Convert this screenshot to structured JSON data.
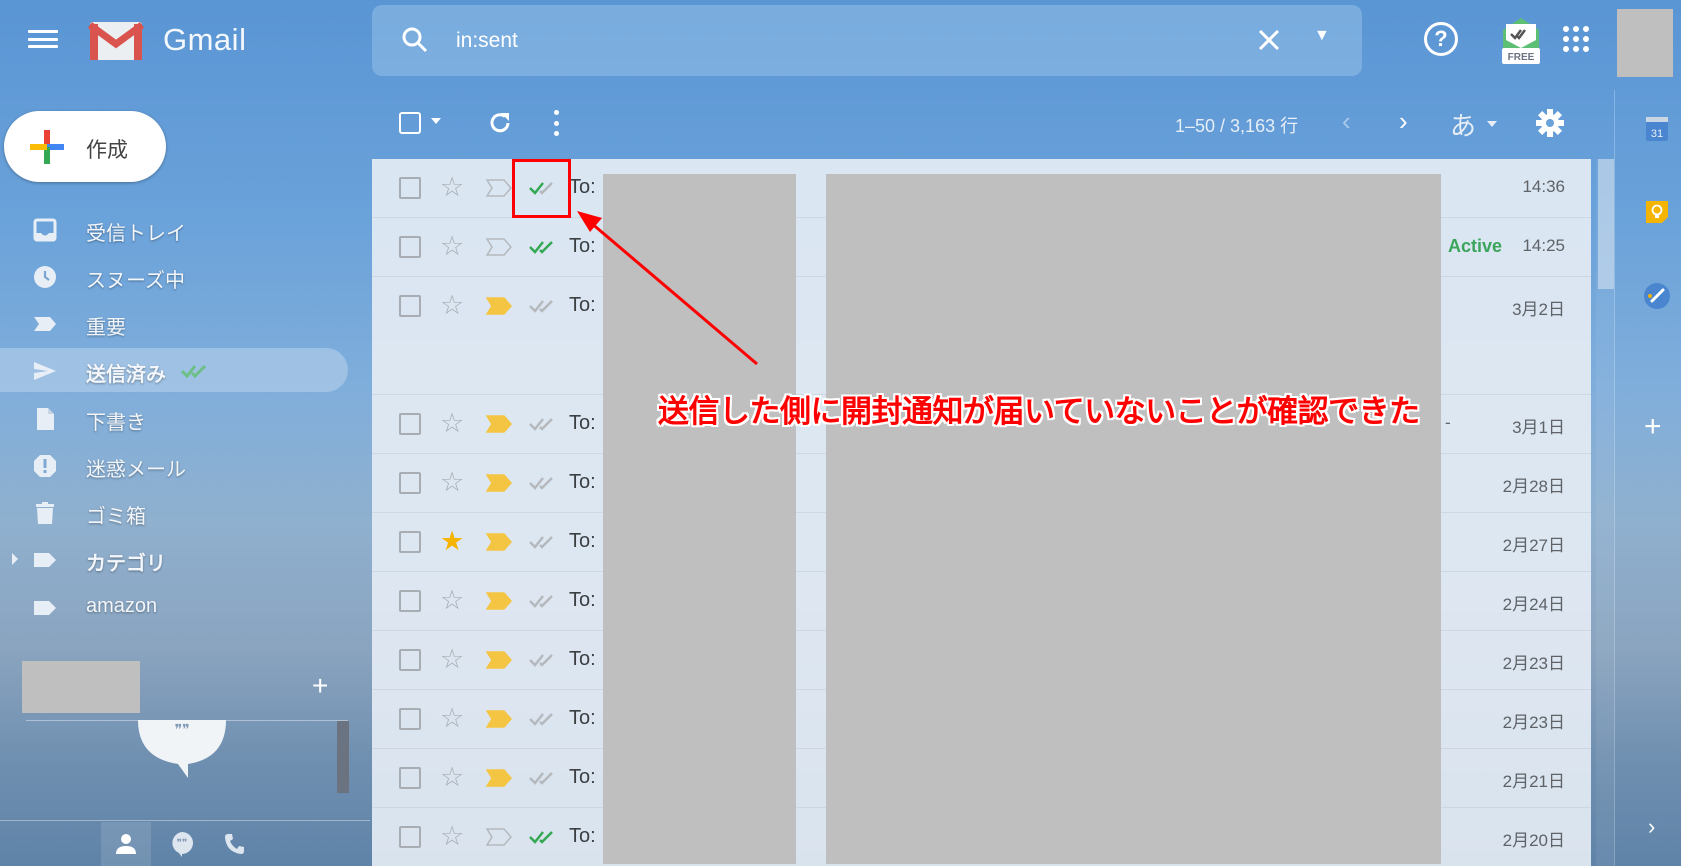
{
  "header": {
    "app_name": "Gmail",
    "search_value": "in:sent",
    "search_clear_icon": "close-icon",
    "search_options_icon": "arrow-drop-down-icon",
    "help_icon": "help-icon",
    "extension_badge": "FREE",
    "apps_icon": "apps-grid-icon"
  },
  "compose": {
    "label": "作成"
  },
  "sidebar": {
    "items": [
      {
        "label": "受信トレイ",
        "icon": "inbox-icon"
      },
      {
        "label": "スヌーズ中",
        "icon": "clock-icon"
      },
      {
        "label": "重要",
        "icon": "important-icon"
      },
      {
        "label": "送信済み",
        "icon": "send-icon",
        "active": true
      },
      {
        "label": "下書き",
        "icon": "draft-icon"
      },
      {
        "label": "迷惑メール",
        "icon": "spam-icon"
      },
      {
        "label": "ゴミ箱",
        "icon": "trash-icon"
      },
      {
        "label": "カテゴリ",
        "icon": "label-icon",
        "expandable": true
      },
      {
        "label": "amazon",
        "icon": "label-icon"
      }
    ]
  },
  "toolbar": {
    "count_text": "1–50 / 3,163 行",
    "language": "あ"
  },
  "mails": [
    {
      "to": "To:",
      "starred": false,
      "important": false,
      "read_status": "partial",
      "active": "",
      "date": "14:36"
    },
    {
      "to": "To:",
      "starred": false,
      "important": false,
      "read_status": "read",
      "active": "Active",
      "date": "14:25"
    },
    {
      "to": "To:",
      "starred": false,
      "important": true,
      "read_status": "unread",
      "active": "",
      "date": "3月2日"
    },
    {
      "to": "To:",
      "starred": false,
      "important": true,
      "read_status": "unread",
      "active": "",
      "date": "3月1日",
      "dash": "-"
    },
    {
      "to": "To:",
      "starred": false,
      "important": true,
      "read_status": "unread",
      "active": "",
      "date": "2月28日"
    },
    {
      "to": "To:",
      "starred": true,
      "important": true,
      "read_status": "unread",
      "active": "",
      "date": "2月27日"
    },
    {
      "to": "To:",
      "starred": false,
      "important": true,
      "read_status": "unread",
      "active": "",
      "date": "2月24日"
    },
    {
      "to": "To:",
      "starred": false,
      "important": true,
      "read_status": "unread",
      "active": "",
      "date": "2月23日"
    },
    {
      "to": "To:",
      "starred": false,
      "important": true,
      "read_status": "unread",
      "active": "",
      "date": "2月23日"
    },
    {
      "to": "To:",
      "starred": false,
      "important": true,
      "read_status": "unread",
      "active": "",
      "date": "2月21日"
    },
    {
      "to": "To:",
      "starred": false,
      "important": false,
      "read_status": "read",
      "active": "",
      "date": "2月20日"
    }
  ],
  "side_panel": {
    "calendar_day": "31"
  },
  "annotation": {
    "text": "送信した側に開封通知が届いていないことが確認できた"
  },
  "colors": {
    "read_green": "#34a853",
    "unread_gray": "#b5b9bd",
    "important_yellow": "#f4c542",
    "star_yellow": "#f4b400",
    "annotation_red": "#ff0000"
  }
}
